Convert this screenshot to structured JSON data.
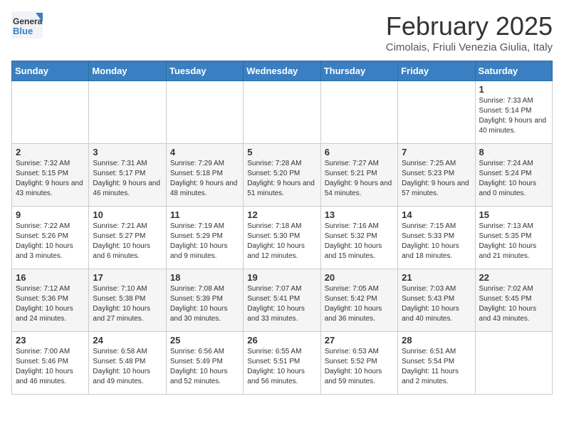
{
  "header": {
    "logo_general": "General",
    "logo_blue": "Blue",
    "month_title": "February 2025",
    "subtitle": "Cimolais, Friuli Venezia Giulia, Italy"
  },
  "days_of_week": [
    "Sunday",
    "Monday",
    "Tuesday",
    "Wednesday",
    "Thursday",
    "Friday",
    "Saturday"
  ],
  "weeks": [
    [
      {
        "day": "",
        "info": ""
      },
      {
        "day": "",
        "info": ""
      },
      {
        "day": "",
        "info": ""
      },
      {
        "day": "",
        "info": ""
      },
      {
        "day": "",
        "info": ""
      },
      {
        "day": "",
        "info": ""
      },
      {
        "day": "1",
        "info": "Sunrise: 7:33 AM\nSunset: 5:14 PM\nDaylight: 9 hours and 40 minutes."
      }
    ],
    [
      {
        "day": "2",
        "info": "Sunrise: 7:32 AM\nSunset: 5:15 PM\nDaylight: 9 hours and 43 minutes."
      },
      {
        "day": "3",
        "info": "Sunrise: 7:31 AM\nSunset: 5:17 PM\nDaylight: 9 hours and 46 minutes."
      },
      {
        "day": "4",
        "info": "Sunrise: 7:29 AM\nSunset: 5:18 PM\nDaylight: 9 hours and 48 minutes."
      },
      {
        "day": "5",
        "info": "Sunrise: 7:28 AM\nSunset: 5:20 PM\nDaylight: 9 hours and 51 minutes."
      },
      {
        "day": "6",
        "info": "Sunrise: 7:27 AM\nSunset: 5:21 PM\nDaylight: 9 hours and 54 minutes."
      },
      {
        "day": "7",
        "info": "Sunrise: 7:25 AM\nSunset: 5:23 PM\nDaylight: 9 hours and 57 minutes."
      },
      {
        "day": "8",
        "info": "Sunrise: 7:24 AM\nSunset: 5:24 PM\nDaylight: 10 hours and 0 minutes."
      }
    ],
    [
      {
        "day": "9",
        "info": "Sunrise: 7:22 AM\nSunset: 5:26 PM\nDaylight: 10 hours and 3 minutes."
      },
      {
        "day": "10",
        "info": "Sunrise: 7:21 AM\nSunset: 5:27 PM\nDaylight: 10 hours and 6 minutes."
      },
      {
        "day": "11",
        "info": "Sunrise: 7:19 AM\nSunset: 5:29 PM\nDaylight: 10 hours and 9 minutes."
      },
      {
        "day": "12",
        "info": "Sunrise: 7:18 AM\nSunset: 5:30 PM\nDaylight: 10 hours and 12 minutes."
      },
      {
        "day": "13",
        "info": "Sunrise: 7:16 AM\nSunset: 5:32 PM\nDaylight: 10 hours and 15 minutes."
      },
      {
        "day": "14",
        "info": "Sunrise: 7:15 AM\nSunset: 5:33 PM\nDaylight: 10 hours and 18 minutes."
      },
      {
        "day": "15",
        "info": "Sunrise: 7:13 AM\nSunset: 5:35 PM\nDaylight: 10 hours and 21 minutes."
      }
    ],
    [
      {
        "day": "16",
        "info": "Sunrise: 7:12 AM\nSunset: 5:36 PM\nDaylight: 10 hours and 24 minutes."
      },
      {
        "day": "17",
        "info": "Sunrise: 7:10 AM\nSunset: 5:38 PM\nDaylight: 10 hours and 27 minutes."
      },
      {
        "day": "18",
        "info": "Sunrise: 7:08 AM\nSunset: 5:39 PM\nDaylight: 10 hours and 30 minutes."
      },
      {
        "day": "19",
        "info": "Sunrise: 7:07 AM\nSunset: 5:41 PM\nDaylight: 10 hours and 33 minutes."
      },
      {
        "day": "20",
        "info": "Sunrise: 7:05 AM\nSunset: 5:42 PM\nDaylight: 10 hours and 36 minutes."
      },
      {
        "day": "21",
        "info": "Sunrise: 7:03 AM\nSunset: 5:43 PM\nDaylight: 10 hours and 40 minutes."
      },
      {
        "day": "22",
        "info": "Sunrise: 7:02 AM\nSunset: 5:45 PM\nDaylight: 10 hours and 43 minutes."
      }
    ],
    [
      {
        "day": "23",
        "info": "Sunrise: 7:00 AM\nSunset: 5:46 PM\nDaylight: 10 hours and 46 minutes."
      },
      {
        "day": "24",
        "info": "Sunrise: 6:58 AM\nSunset: 5:48 PM\nDaylight: 10 hours and 49 minutes."
      },
      {
        "day": "25",
        "info": "Sunrise: 6:56 AM\nSunset: 5:49 PM\nDaylight: 10 hours and 52 minutes."
      },
      {
        "day": "26",
        "info": "Sunrise: 6:55 AM\nSunset: 5:51 PM\nDaylight: 10 hours and 56 minutes."
      },
      {
        "day": "27",
        "info": "Sunrise: 6:53 AM\nSunset: 5:52 PM\nDaylight: 10 hours and 59 minutes."
      },
      {
        "day": "28",
        "info": "Sunrise: 6:51 AM\nSunset: 5:54 PM\nDaylight: 11 hours and 2 minutes."
      },
      {
        "day": "",
        "info": ""
      }
    ]
  ]
}
